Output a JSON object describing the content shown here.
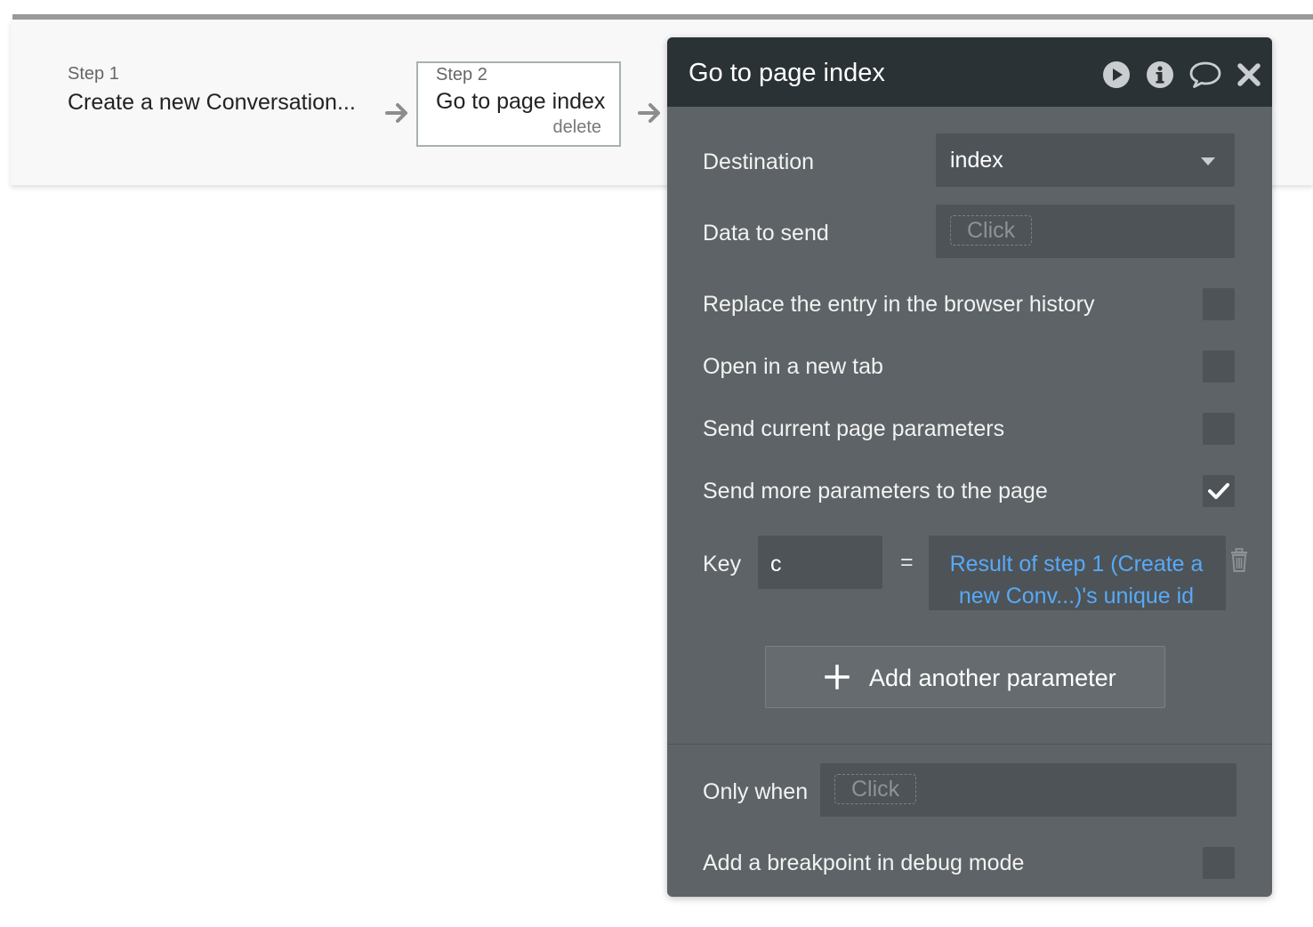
{
  "workflow": {
    "step1": {
      "label": "Step 1",
      "title": "Create a new Conversation..."
    },
    "step2": {
      "label": "Step 2",
      "title": "Go to page index",
      "delete_label": "delete"
    }
  },
  "panel": {
    "title": "Go to page index",
    "header_icons": [
      "play-icon",
      "info-icon",
      "comment-icon",
      "close-icon"
    ],
    "destination": {
      "label": "Destination",
      "value": "index"
    },
    "data_to_send": {
      "label": "Data to send",
      "placeholder": "Click"
    },
    "options": [
      {
        "label": "Replace the entry in the browser history",
        "checked": false
      },
      {
        "label": "Open in a new tab",
        "checked": false
      },
      {
        "label": "Send current page parameters",
        "checked": false
      },
      {
        "label": "Send more parameters to the page",
        "checked": true
      }
    ],
    "parameter": {
      "key_label": "Key",
      "key_value": "c",
      "equals": "=",
      "value_line1": "Result of step 1 (Create a",
      "value_line2": "new Conv...)'s unique id"
    },
    "add_parameter_label": "Add another parameter",
    "only_when": {
      "label": "Only when",
      "placeholder": "Click"
    },
    "breakpoint": {
      "label": "Add a breakpoint in debug mode",
      "checked": false
    }
  },
  "colors": {
    "panel_bg": "#5d6366",
    "header_bg": "#2b3235",
    "expression_link": "#58a9f7"
  }
}
